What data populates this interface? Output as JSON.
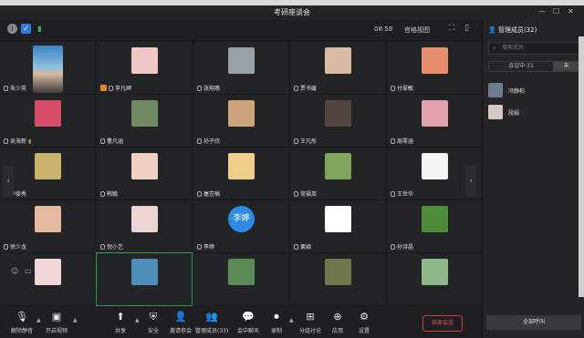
{
  "window": {
    "title": "考研座谈会"
  },
  "top": {
    "timer": "08:58",
    "view_label": "宫格视图"
  },
  "tiles": [
    {
      "name": "朱少英",
      "kind": "photo"
    },
    {
      "name": "李凡岬",
      "kind": "img",
      "color": "#f1c7c5",
      "host": true
    },
    {
      "name": "张翔燕",
      "kind": "img",
      "color": "#9aa1a6"
    },
    {
      "name": "贾书媛",
      "kind": "img",
      "color": "#d9bba6"
    },
    {
      "name": "付翠敏",
      "kind": "img",
      "color": "#e58f6f"
    },
    {
      "name": "吴海新",
      "kind": "img",
      "color": "#d64d6a",
      "signal": true
    },
    {
      "name": "曹凡涵",
      "kind": "img",
      "color": "#6f8a62"
    },
    {
      "name": "孙子欣",
      "kind": "img",
      "color": "#caa57b"
    },
    {
      "name": "王凡彤",
      "kind": "img",
      "color": "#514441"
    },
    {
      "name": "周零涵",
      "kind": "img",
      "color": "#e0a3ad"
    },
    {
      "name": "李俊秀",
      "kind": "img",
      "color": "#c9b36c"
    },
    {
      "name": "韩毓",
      "kind": "img",
      "color": "#f0d0c3"
    },
    {
      "name": "屠笠楠",
      "kind": "img",
      "color": "#efd08b"
    },
    {
      "name": "常福英",
      "kind": "img",
      "color": "#7ea35b"
    },
    {
      "name": "王世华",
      "kind": "img",
      "color": "#f3f3f3"
    },
    {
      "name": "徐少龙",
      "kind": "img",
      "color": "#e4b9a2"
    },
    {
      "name": "倪小艺",
      "kind": "img",
      "color": "#eed3d4"
    },
    {
      "name": "李婷",
      "kind": "circle",
      "color": "#2e8be5",
      "text": "李婷"
    },
    {
      "name": "栗颖",
      "kind": "img",
      "color": "#ffffff"
    },
    {
      "name": "孙诗晶",
      "kind": "img",
      "color": "#4f8c3a"
    },
    {
      "name": "",
      "kind": "img",
      "color": "#f2d7d8"
    },
    {
      "name": "",
      "kind": "img",
      "color": "#4d8fb8",
      "selected": true
    },
    {
      "name": "",
      "kind": "img",
      "color": "#5b8a56"
    },
    {
      "name": "",
      "kind": "img",
      "color": "#6d7a4c"
    },
    {
      "name": "",
      "kind": "img",
      "color": "#8fb88a"
    }
  ],
  "toolbar": {
    "unmute": "解除静音",
    "video": "开启视频",
    "share": "共享",
    "security": "安全",
    "invite": "邀请参会",
    "manage": "管理成员(33)",
    "chat": "会中聊天",
    "record": "录制",
    "breakout": "分组讨论",
    "apps": "应用",
    "settings": "设置",
    "end": "结束会议"
  },
  "panel": {
    "title": "管理成员(32)",
    "search_placeholder": "搜索成员",
    "tab_in": "会议中·31",
    "tab_other": "未",
    "members": [
      {
        "name": "冯静柏",
        "color": "#6c7c8c"
      },
      {
        "name": "段娟",
        "color": "#d8c8c2"
      }
    ],
    "call_all": "全部呼叫"
  }
}
